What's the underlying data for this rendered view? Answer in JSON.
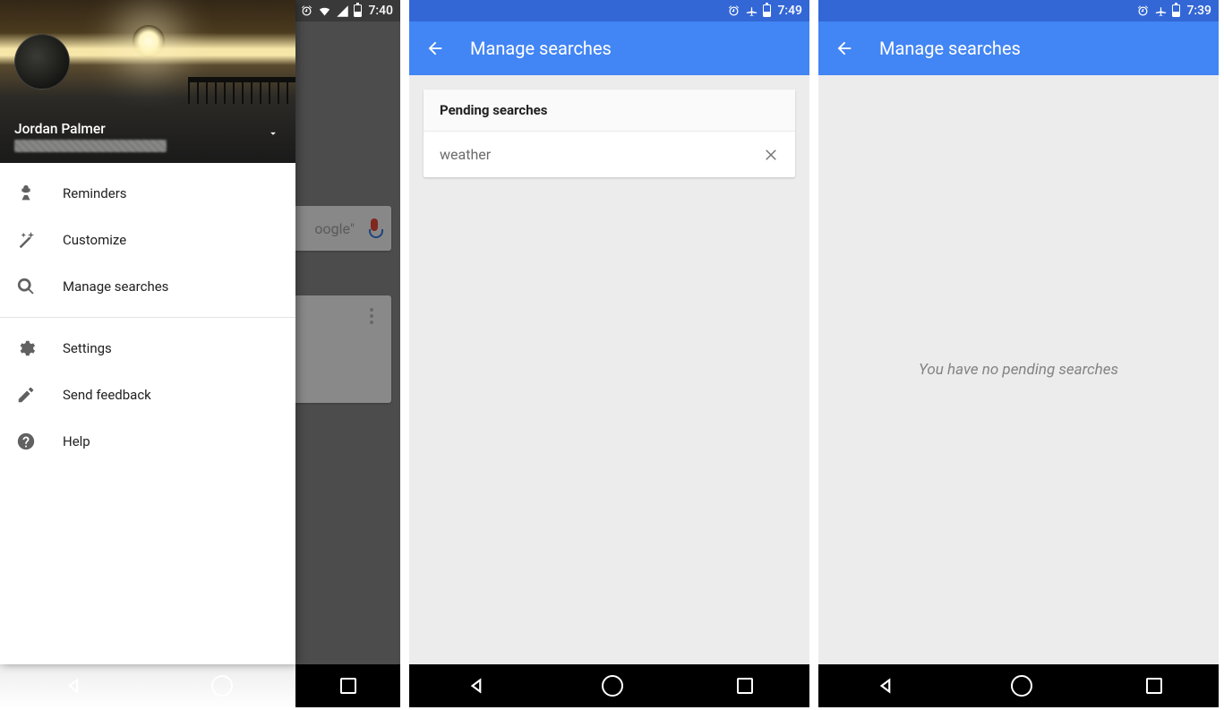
{
  "phones": [
    {
      "status": {
        "time": "7:40"
      },
      "background": {
        "search_hint_fragment": "oogle\"",
        "voice_icon": "mic-icon"
      },
      "drawer": {
        "user_name": "Jordan Palmer",
        "menu": {
          "reminders": "Reminders",
          "customize": "Customize",
          "manage_searches": "Manage searches",
          "settings": "Settings",
          "send_feedback": "Send feedback",
          "help": "Help"
        }
      }
    },
    {
      "status": {
        "time": "7:49"
      },
      "appbar": {
        "title": "Manage searches"
      },
      "card": {
        "header": "Pending searches",
        "items": [
          {
            "label": "weather"
          }
        ]
      }
    },
    {
      "status": {
        "time": "7:39"
      },
      "appbar": {
        "title": "Manage searches"
      },
      "empty_message": "You have no pending searches"
    }
  ]
}
